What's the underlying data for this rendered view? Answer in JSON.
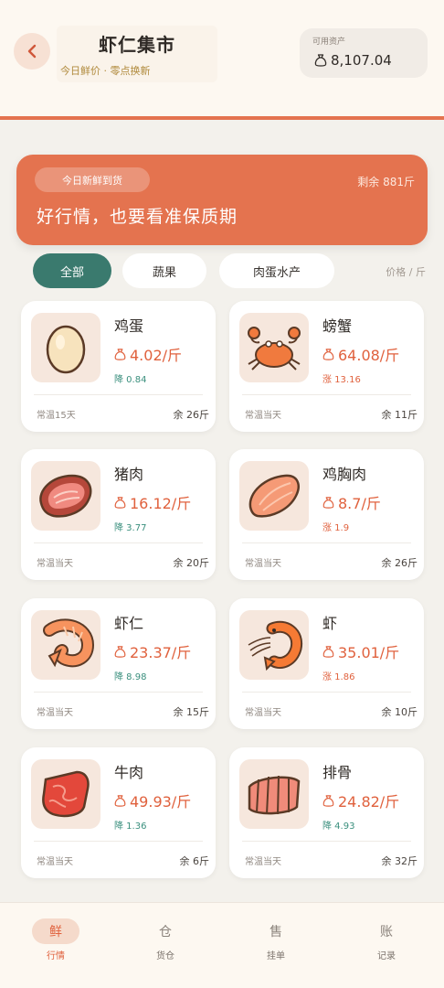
{
  "header": {
    "title": "虾仁集市",
    "subtitle": "今日鲜价 · 零点换新",
    "asset_label": "可用资产",
    "asset_value": "8,107.04"
  },
  "banner": {
    "badge": "今日新鲜到货",
    "remaining": "剩余 881斤",
    "headline": "好行情，也要看准保质期"
  },
  "filters": {
    "all": "全部",
    "vegetables": "蔬果",
    "meat": "肉蛋水产",
    "unit_hint": "价格 / 斤"
  },
  "products": [
    {
      "name": "鸡蛋",
      "price": "4.02/斤",
      "change": "降 0.84",
      "dir": "down",
      "storage": "常温15天",
      "stock": "余 26斤",
      "icon": "egg-icon"
    },
    {
      "name": "螃蟹",
      "price": "64.08/斤",
      "change": "涨 13.16",
      "dir": "up",
      "storage": "常温当天",
      "stock": "余 11斤",
      "icon": "crab-icon"
    },
    {
      "name": "猪肉",
      "price": "16.12/斤",
      "change": "降 3.77",
      "dir": "down",
      "storage": "常温当天",
      "stock": "余 20斤",
      "icon": "pork-icon"
    },
    {
      "name": "鸡胸肉",
      "price": "8.7/斤",
      "change": "涨 1.9",
      "dir": "up",
      "storage": "常温当天",
      "stock": "余 26斤",
      "icon": "chicken-breast-icon"
    },
    {
      "name": "虾仁",
      "price": "23.37/斤",
      "change": "降 8.98",
      "dir": "down",
      "storage": "常温当天",
      "stock": "余 15斤",
      "icon": "peeled-shrimp-icon"
    },
    {
      "name": "虾",
      "price": "35.01/斤",
      "change": "涨 1.86",
      "dir": "up",
      "storage": "常温当天",
      "stock": "余 10斤",
      "icon": "shrimp-icon"
    },
    {
      "name": "牛肉",
      "price": "49.93/斤",
      "change": "降 1.36",
      "dir": "down",
      "storage": "常温当天",
      "stock": "余 6斤",
      "icon": "beef-icon"
    },
    {
      "name": "排骨",
      "price": "24.82/斤",
      "change": "降 4.93",
      "dir": "down",
      "storage": "常温当天",
      "stock": "余 32斤",
      "icon": "ribs-icon"
    }
  ],
  "nav": [
    {
      "icon_text": "鲜",
      "label": "行情",
      "active": true
    },
    {
      "icon_text": "仓",
      "label": "货仓",
      "active": false
    },
    {
      "icon_text": "售",
      "label": "挂单",
      "active": false
    },
    {
      "icon_text": "账",
      "label": "记录",
      "active": false
    }
  ],
  "colors": {
    "accent": "#e4734f",
    "active_tab": "#3a7a6e",
    "price": "#e0613d",
    "down": "#3a8f7d"
  }
}
